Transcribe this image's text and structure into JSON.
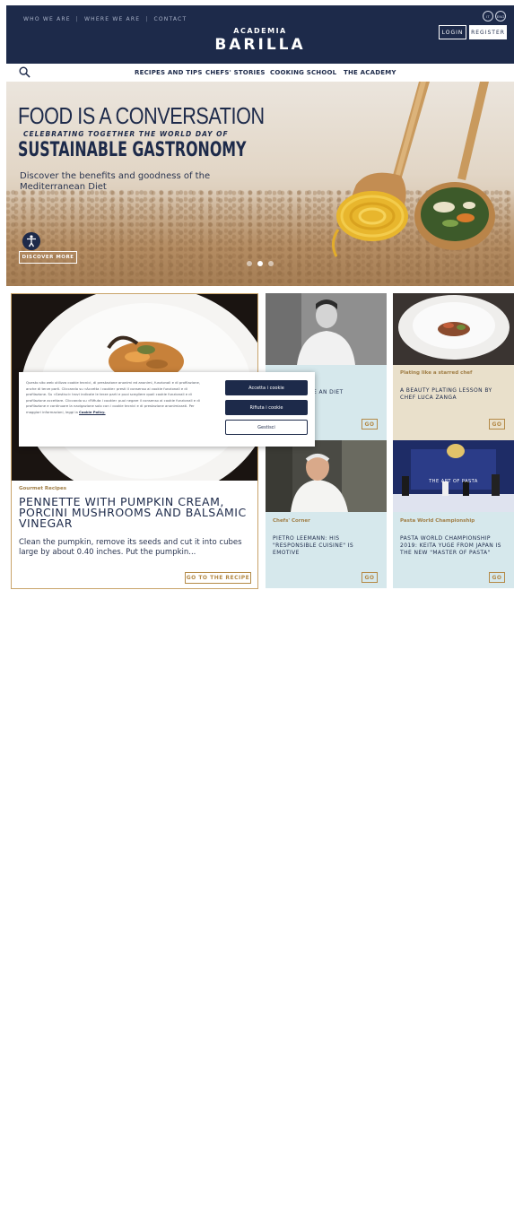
{
  "header": {
    "top_links": [
      "WHO WE ARE",
      "WHERE WE ARE",
      "CONTACT"
    ],
    "separator": "|",
    "brand_top": "ACADEMIA",
    "brand_main": "BARILLA",
    "lang_it": "IT",
    "lang_en": "ENG",
    "login": "LOGIN",
    "register": "REGISTER"
  },
  "nav": {
    "items": [
      "RECIPES AND TIPS",
      "CHEFS' STORIES",
      "COOKING SCHOOL",
      "THE ACADEMY"
    ]
  },
  "hero": {
    "title": "FOOD IS A CONVERSATION",
    "subtitle": "CELEBRATING TOGETHER THE WORLD DAY OF",
    "title2": "SUSTAINABLE GASTRONOMY",
    "description": "Discover the benefits and goodness of the Mediterranean Diet",
    "button": "DISCOVER MORE",
    "slide_active": 2,
    "slide_count": 3
  },
  "main_card": {
    "category": "Gourmet Recipes",
    "title": "PENNETTE WITH PUMPKIN CREAM, PORCINI MUSHROOMS AND BALSAMIC VINEGAR",
    "description": "Clean the pumpkin, remove its seeds and cut it into cubes large by about 0.40 inches.   Put the pumpkin...",
    "button": "GO TO THE RECIPE"
  },
  "cards": [
    {
      "category": "",
      "title": "UTURE OF THE AN DIET",
      "button": "GO"
    },
    {
      "category": "Plating like a starred chef",
      "title": "A BEAUTY PLATING LESSON BY CHEF LUCA ZANGA",
      "button": "GO"
    },
    {
      "category": "Chefs' Corner",
      "title": "PIETRO LEEMANN: HIS \"RESPONSIBLE CUISINE\" IS EMOTIVE",
      "button": "GO"
    },
    {
      "category": "Pasta World Championship",
      "title": "PASTA WORLD CHAMPIONSHIP 2019: KEITA YUGE FROM JAPAN IS THE NEW \"MASTER OF PASTA\"",
      "button": "GO"
    }
  ],
  "banner_text": "THE ART OF PASTA",
  "cookie": {
    "text": "Questo sito web utilizza cookie tecnici, di prestazione anonimi ed anonimi, funzionali e di profilazione, anche di terze parti. Cliccando su «Accetta i cookie» presti il consenso ai cookie funzionali e di profilazione. Su «Gestisci» trovi indicate le terze parti e puoi scegliere quali cookie funzionali e di profilazione accettare. Cliccando su «Rifiuta i cookie» puoi negare il consenso ai cookie funzionali e di profilazione e continuare la navigazione solo con i cookie tecnici e di prestazione anonimizzati. Per maggiori informazioni, leggi la",
    "link": "Cookie Policy.",
    "accept": "Accetta i cookie",
    "reject": "Rifiuta i cookie",
    "manage": "Gestisci"
  },
  "colors": {
    "navy": "#1d2a4a",
    "gold": "#b48a47",
    "card_blue": "#d6e8ec",
    "card_beige": "#e9e0cb"
  }
}
